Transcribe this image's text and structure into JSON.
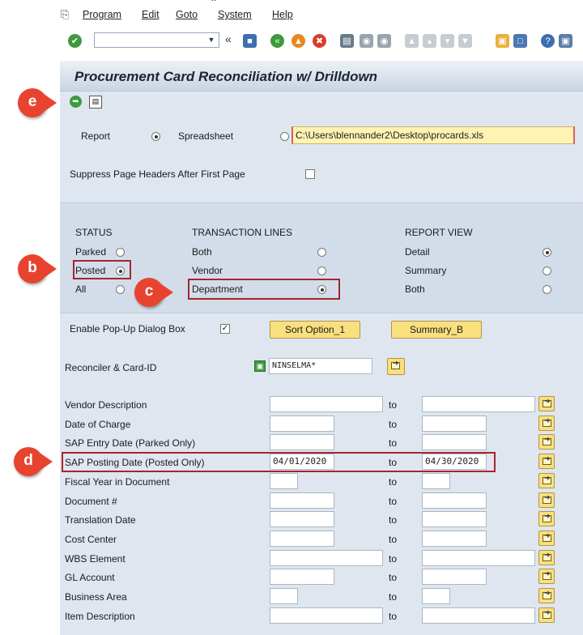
{
  "menu": [
    "Program",
    "Edit",
    "Goto",
    "System",
    "Help"
  ],
  "icons": [
    "program-menu-icon",
    "check-icon",
    "back-icon",
    "save-icon",
    "exit-icon",
    "cancel-icon",
    "print-icon",
    "find-icon",
    "find-next-icon",
    "help-icon",
    "layout-icon"
  ],
  "title": "Procurement Card Reconciliation w/ Drilldown",
  "output": {
    "report_label": "Report",
    "spreadsheet_label": "Spreadsheet",
    "spreadsheet_path": "C:\\Users\\blennander2\\Desktop\\procards.xls",
    "report_selected": true
  },
  "suppress_label": "Suppress Page Headers After First Page",
  "status": {
    "heading": "STATUS",
    "options": [
      "Parked",
      "Posted",
      "All"
    ],
    "selected": "Posted"
  },
  "transaction_lines": {
    "heading": "TRANSACTION LINES",
    "options": [
      "Both",
      "Vendor",
      "Department"
    ],
    "selected": "Department"
  },
  "report_view": {
    "heading": "REPORT VIEW",
    "options": [
      "Detail",
      "Summary",
      "Both"
    ],
    "selected": "Detail"
  },
  "popup_label": "Enable Pop-Up Dialog Box",
  "popup_checked": true,
  "sort_button": "Sort Option_1",
  "summary_button": "Summary_B",
  "reconciler": {
    "label": "Reconciler & Card-ID",
    "value": "NINSELMA*"
  },
  "to_label": "to",
  "fields": [
    {
      "label": "Vendor Description",
      "from": "",
      "to": ""
    },
    {
      "label": "Date of Charge",
      "from": "",
      "to": ""
    },
    {
      "label": "SAP Entry Date   (Parked Only)",
      "from": "",
      "to": ""
    },
    {
      "label": "SAP Posting Date (Posted Only)",
      "from": "04/01/2020",
      "to": "04/30/2020"
    },
    {
      "label": "Fiscal Year in Document",
      "from": "",
      "to": ""
    },
    {
      "label": "Document #",
      "from": "",
      "to": ""
    },
    {
      "label": "Translation Date",
      "from": "",
      "to": ""
    },
    {
      "label": "Cost Center",
      "from": "",
      "to": ""
    },
    {
      "label": "WBS Element",
      "from": "",
      "to": ""
    },
    {
      "label": "GL Account",
      "from": "",
      "to": ""
    },
    {
      "label": "Business Area",
      "from": "",
      "to": ""
    },
    {
      "label": "Item Description",
      "from": "",
      "to": ""
    }
  ],
  "markers": {
    "b": "b",
    "c": "c",
    "d": "d",
    "e": "e"
  },
  "colors": {
    "highlight": "#a4262c",
    "marker": "#e8432f",
    "button": "#f9e07e",
    "panel": "#dfe6ef"
  }
}
